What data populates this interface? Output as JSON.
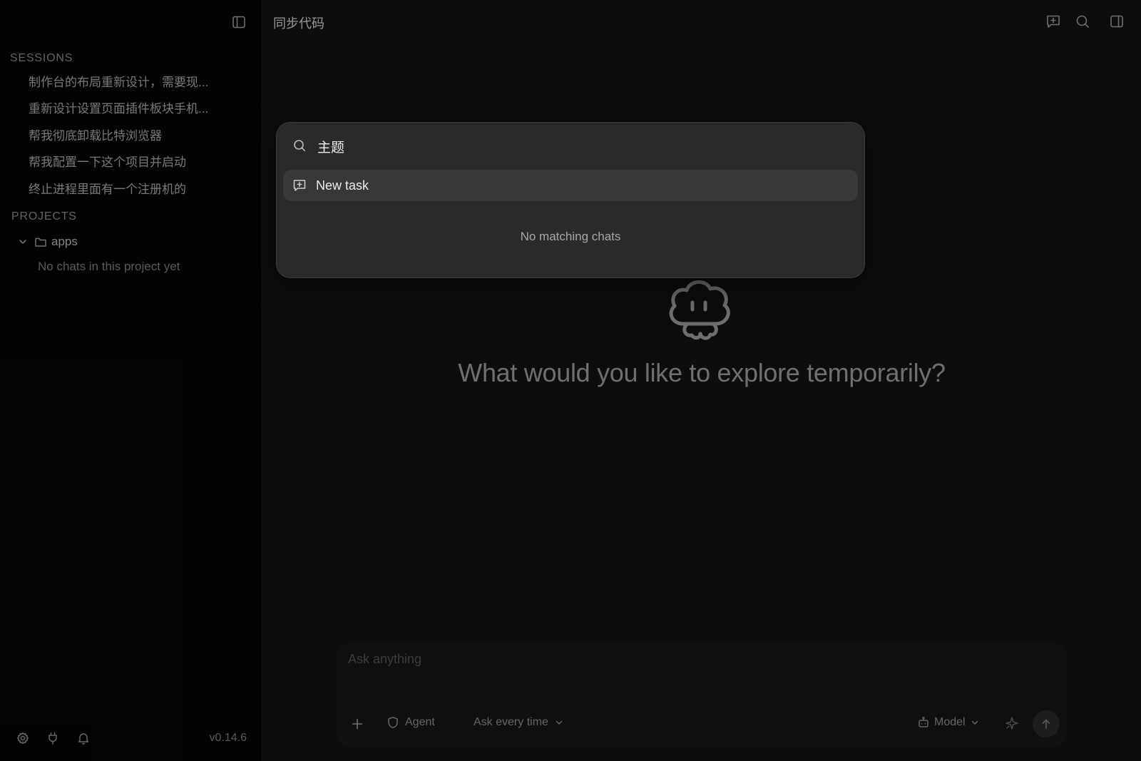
{
  "window": {
    "title": "同步代码"
  },
  "sidebar": {
    "sessions_heading": "SESSIONS",
    "sessions": [
      {
        "label": "制作台的布局重新设计，需要现..."
      },
      {
        "label": "重新设计设置页面插件板块手机..."
      },
      {
        "label": "帮我彻底卸载比特浏览器"
      },
      {
        "label": "帮我配置一下这个项目并启动"
      },
      {
        "label": "终止进程里面有一个注册机的"
      }
    ],
    "projects_heading": "PROJECTS",
    "projects": [
      {
        "name": "apps",
        "expanded": true,
        "empty_text": "No chats in this project yet"
      }
    ],
    "footer": {
      "icons": [
        "gear-icon",
        "plug-icon",
        "bell-icon"
      ],
      "version": "v0.14.6"
    }
  },
  "topbar": {
    "icons": [
      "new-chat-icon",
      "search-icon",
      "right-panel-icon"
    ]
  },
  "hero": {
    "mascot_icon": "cloud-mascot-icon",
    "text": "What would you like to explore temporarily?"
  },
  "composer": {
    "placeholder": "Ask anything",
    "agent_label": "Agent",
    "permission_label": "Ask every time",
    "model_label": "Model"
  },
  "palette": {
    "query": "主题",
    "items": [
      {
        "label": "New task",
        "icon": "new-chat-icon"
      }
    ],
    "empty_text": "No matching chats"
  },
  "colors": {
    "background": "#131313",
    "sidebar": "#050505",
    "palette": "#2a2a2a",
    "palette_highlight": "#383838"
  }
}
